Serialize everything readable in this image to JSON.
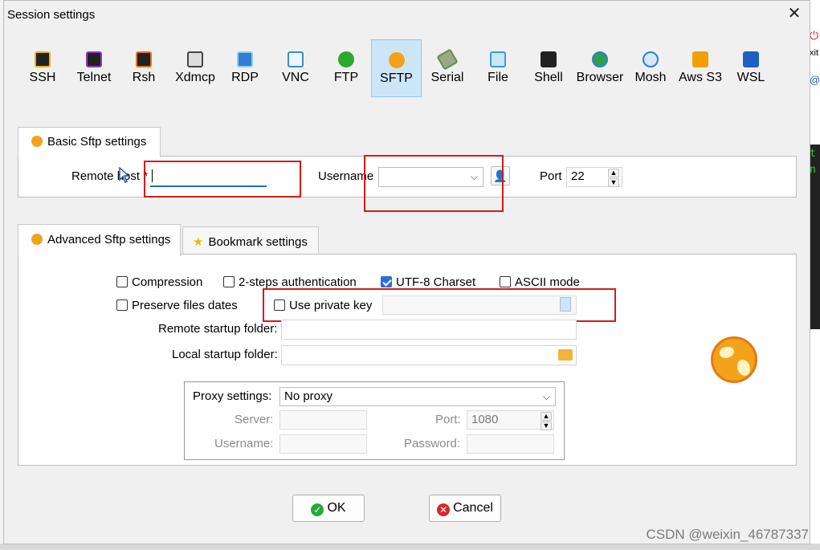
{
  "dialog": {
    "title": "Session settings",
    "close_glyph": "✕"
  },
  "session_types": [
    {
      "label": "SSH",
      "icon": "ssh-icon",
      "color": "#e8b30f"
    },
    {
      "label": "Telnet",
      "icon": "telnet-icon",
      "color": "#8a3cc9"
    },
    {
      "label": "Rsh",
      "icon": "rsh-icon",
      "color": "#e6751c"
    },
    {
      "label": "Xdmcp",
      "icon": "xdmcp-icon",
      "color": "#444444"
    },
    {
      "label": "RDP",
      "icon": "rdp-icon",
      "color": "#2d7fd3"
    },
    {
      "label": "VNC",
      "icon": "vnc-icon",
      "color": "#3a8fc9"
    },
    {
      "label": "FTP",
      "icon": "ftp-icon",
      "color": "#2fa82f"
    },
    {
      "label": "SFTP",
      "icon": "sftp-icon",
      "color": "#f3a219"
    },
    {
      "label": "Serial",
      "icon": "serial-icon",
      "color": "#6b8a4a"
    },
    {
      "label": "File",
      "icon": "file-icon",
      "color": "#3c9ad6"
    },
    {
      "label": "Shell",
      "icon": "shell-icon",
      "color": "#222222"
    },
    {
      "label": "Browser",
      "icon": "browser-icon",
      "color": "#2f9f4f"
    },
    {
      "label": "Mosh",
      "icon": "mosh-icon",
      "color": "#2e7fd0"
    },
    {
      "label": "Aws S3",
      "icon": "aws-s3-icon",
      "color": "#f0a000"
    },
    {
      "label": "WSL",
      "icon": "wsl-icon",
      "color": "#1f5fbf"
    }
  ],
  "basic": {
    "tab_label": "Basic Sftp settings",
    "remote_host_label": "Remote host *",
    "remote_host_value": "",
    "username_label": "Username",
    "username_value": "",
    "port_label": "Port",
    "port_value": "22"
  },
  "advanced": {
    "tab_label": "Advanced Sftp settings",
    "bookmark_tab_label": "Bookmark settings",
    "compression_label": "Compression",
    "two_step_label": "2-steps authentication",
    "utf8_label": "UTF-8 Charset",
    "ascii_label": "ASCII mode",
    "preserve_label": "Preserve files dates",
    "private_key_label": "Use private key",
    "remote_folder_label": "Remote startup folder:",
    "local_folder_label": "Local startup folder:",
    "proxy_label": "Proxy settings:",
    "proxy_value": "No proxy",
    "server_label": "Server:",
    "proxy_port_label": "Port:",
    "proxy_port_value": "1080",
    "proxy_user_label": "Username:",
    "proxy_pass_label": "Password:"
  },
  "buttons": {
    "ok": "OK",
    "cancel": "Cancel"
  },
  "background": {
    "exit_text": "xit",
    "term_line1": "t",
    "term_line2": "n"
  },
  "watermark": "CSDN @weixin_46787337"
}
